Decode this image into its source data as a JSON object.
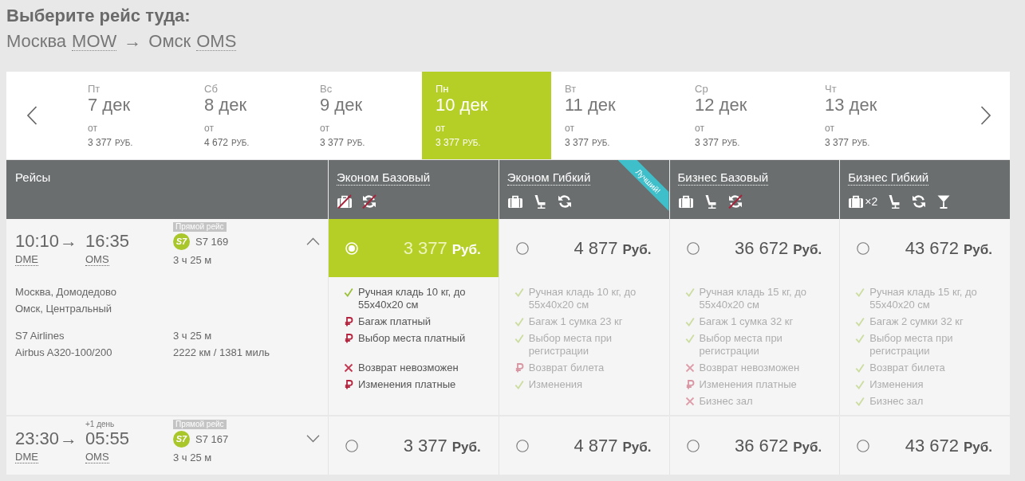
{
  "heading": {
    "title": "Выберите рейс туда:",
    "origin_city": "Москва",
    "origin_code": "MOW",
    "arrow": "→",
    "destination_city": "Омск",
    "destination_code": "OMS"
  },
  "date_strip": {
    "dates": [
      {
        "weekday": "Пт",
        "date": "7 дек",
        "from_label": "от",
        "price": "3 377",
        "currency": "РУБ.",
        "selected": false
      },
      {
        "weekday": "Сб",
        "date": "8 дек",
        "from_label": "от",
        "price": "4 672",
        "currency": "РУБ.",
        "selected": false
      },
      {
        "weekday": "Вс",
        "date": "9 дек",
        "from_label": "от",
        "price": "3 377",
        "currency": "РУБ.",
        "selected": false
      },
      {
        "weekday": "Пн",
        "date": "10 дек",
        "from_label": "от",
        "price": "3 377",
        "currency": "РУБ.",
        "selected": true
      },
      {
        "weekday": "Вт",
        "date": "11 дек",
        "from_label": "от",
        "price": "3 377",
        "currency": "РУБ.",
        "selected": false
      },
      {
        "weekday": "Ср",
        "date": "12 дек",
        "from_label": "от",
        "price": "3 377",
        "currency": "РУБ.",
        "selected": false
      },
      {
        "weekday": "Чт",
        "date": "13 дек",
        "from_label": "от",
        "price": "3 377",
        "currency": "РУБ.",
        "selected": false
      }
    ]
  },
  "table": {
    "flights_header": "Рейсы",
    "fares": [
      {
        "name": "Эконом Базовый",
        "icons": [
          {
            "kind": "baggage",
            "crossed": true
          },
          {
            "kind": "exchange",
            "crossed": true
          }
        ]
      },
      {
        "name": "Эконом Гибкий",
        "ribbon": "Лучший!",
        "icons": [
          {
            "kind": "baggage",
            "crossed": false
          },
          {
            "kind": "seat",
            "crossed": false
          },
          {
            "kind": "exchange",
            "crossed": false
          }
        ]
      },
      {
        "name": "Бизнес Базовый",
        "icons": [
          {
            "kind": "baggage",
            "crossed": false
          },
          {
            "kind": "seat",
            "crossed": false
          },
          {
            "kind": "exchange",
            "crossed": true
          }
        ]
      },
      {
        "name": "Бизнес Гибкий",
        "icons": [
          {
            "kind": "baggage",
            "crossed": false,
            "count": "×2"
          },
          {
            "kind": "seat",
            "crossed": false
          },
          {
            "kind": "exchange",
            "crossed": false
          },
          {
            "kind": "lounge",
            "crossed": false
          }
        ]
      }
    ]
  },
  "flights": [
    {
      "departure_time": "10:10",
      "arrow": "→",
      "arrival_time": "16:35",
      "departure_airport": "DME",
      "arrival_airport": "OMS",
      "badge": "Прямой рейс",
      "airline_logo": "S7",
      "flight_number": "S7 169",
      "duration": "3 ч 25 м",
      "expanded": true,
      "details": {
        "departure_airport_name": "Москва, Домодедово",
        "arrival_airport_name": "Омск, Центральный",
        "airline": "S7 Airlines",
        "duration": "3 ч 25 м",
        "aircraft": "Airbus A320-100/200",
        "distance": "2222 км / 1381 миль"
      },
      "fares": [
        {
          "price": "3 377",
          "currency": "Руб.",
          "selected": true,
          "features": [
            {
              "kind": "included",
              "text": "Ручная кладь 10 кг, до 55x40x20 см"
            },
            {
              "kind": "paid",
              "text": "Багаж платный"
            },
            {
              "kind": "paid",
              "text": "Выбор места платный"
            },
            {
              "kind": "unavailable",
              "text": "Возврат невозможен"
            },
            {
              "kind": "paid",
              "text": "Изменения платные"
            }
          ]
        },
        {
          "price": "4 877",
          "currency": "Руб.",
          "selected": false,
          "features": [
            {
              "kind": "included",
              "text": "Ручная кладь 10 кг, до 55x40x20 см"
            },
            {
              "kind": "included",
              "text": "Багаж 1 сумка 23 кг"
            },
            {
              "kind": "included",
              "text": "Выбор места при регистрации"
            },
            {
              "kind": "paid",
              "text": "Возврат билета"
            },
            {
              "kind": "included",
              "text": "Изменения"
            }
          ]
        },
        {
          "price": "36 672",
          "currency": "Руб.",
          "selected": false,
          "features": [
            {
              "kind": "included",
              "text": "Ручная кладь 15 кг, до 55x40x20 см"
            },
            {
              "kind": "included",
              "text": "Багаж 1 сумка 32 кг"
            },
            {
              "kind": "included",
              "text": "Выбор места при регистрации"
            },
            {
              "kind": "unavailable",
              "text": "Возврат невозможен"
            },
            {
              "kind": "paid",
              "text": "Изменения платные"
            },
            {
              "kind": "unavailable",
              "text": "Бизнес зал"
            }
          ]
        },
        {
          "price": "43 672",
          "currency": "Руб.",
          "selected": false,
          "features": [
            {
              "kind": "included",
              "text": "Ручная кладь 15 кг, до 55x40x20 см"
            },
            {
              "kind": "included",
              "text": "Багаж 2 сумки 32 кг"
            },
            {
              "kind": "included",
              "text": "Выбор места при регистрации"
            },
            {
              "kind": "included",
              "text": "Возврат билета"
            },
            {
              "kind": "included",
              "text": "Изменения"
            },
            {
              "kind": "included",
              "text": "Бизнес зал"
            }
          ]
        }
      ]
    },
    {
      "departure_time": "23:30",
      "arrow": "→",
      "arrival_time": "05:55",
      "next_day": "+1 день",
      "departure_airport": "DME",
      "arrival_airport": "OMS",
      "badge": "Прямой рейс",
      "airline_logo": "S7",
      "flight_number": "S7 167",
      "duration": "3 ч 25 м",
      "expanded": false,
      "fares": [
        {
          "price": "3 377",
          "currency": "Руб.",
          "selected": false
        },
        {
          "price": "4 877",
          "currency": "Руб.",
          "selected": false
        },
        {
          "price": "36 672",
          "currency": "Руб.",
          "selected": false
        },
        {
          "price": "43 672",
          "currency": "Руб.",
          "selected": false
        }
      ]
    }
  ]
}
